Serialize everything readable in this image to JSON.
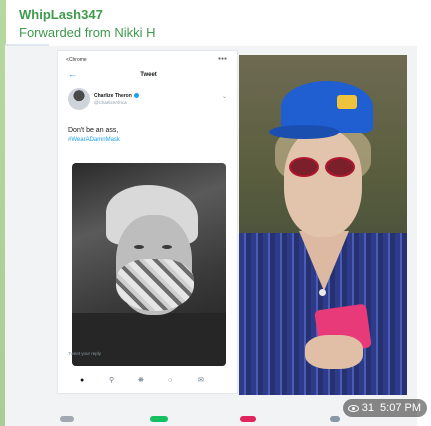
{
  "message": {
    "sender": "WhipLash347",
    "forwarded_from": "Forwarded from Nikki H",
    "views": "31",
    "time": "5:07 PM"
  },
  "tweet": {
    "status_time": "<Chrome",
    "status_icons": "●●●",
    "header_title": "Tweet",
    "author_name": "Charlize Theron",
    "author_handle": "@CharlizeAfrica",
    "text": "Don't be an ass,",
    "hashtag": "#WearADamnMask",
    "reply_placeholder": "Tweet your reply"
  },
  "icons": {
    "back": "back-arrow-icon",
    "home": "home-icon",
    "search": "search-icon",
    "spaces": "spaces-icon",
    "notifications": "bell-icon",
    "messages": "mail-icon",
    "views": "eye-icon"
  },
  "colors": {
    "sender": "#3e9a4c",
    "twitter_blue": "#1da1f2",
    "badge_bg": "rgba(0,0,0,0.45)"
  }
}
